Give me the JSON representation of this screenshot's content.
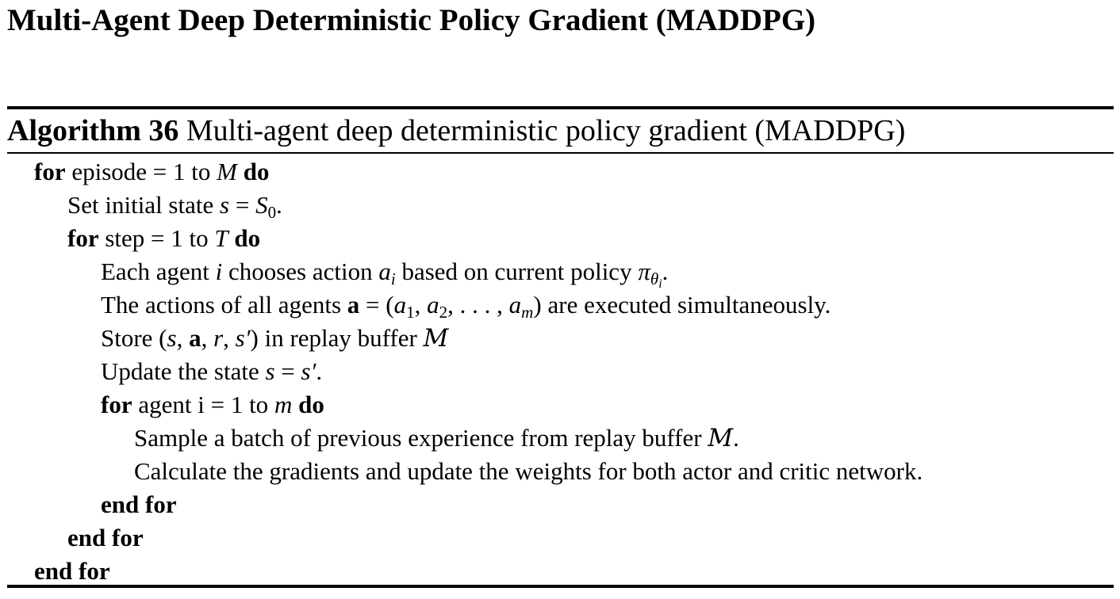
{
  "heading": "Multi-Agent Deep Deterministic Policy Gradient (MADDPG)",
  "algorithm": {
    "number_label": "Algorithm 36",
    "title": "Multi-agent deep deterministic policy gradient (MADDPG)"
  },
  "keywords": {
    "for": "for",
    "do": "do",
    "end_for": "end for"
  },
  "lines": {
    "l1_text": "episode = 1 to",
    "l1_var": "M",
    "l2_text": "Set initial state",
    "l2_var": "s",
    "l2_eq": "=",
    "l2_state": "S",
    "l2_sub": "0",
    "l2_end": ".",
    "l3_text": "step = 1 to",
    "l3_var": "T",
    "l4_a": "Each agent",
    "l4_i": "i",
    "l4_b": "chooses action",
    "l4_ai": "a",
    "l4_ai_sub": "i",
    "l4_c": "based on current policy",
    "l4_pi": "π",
    "l4_theta": "θ",
    "l4_theta_sub": "i",
    "l4_end": ".",
    "l5_a": "The actions of all agents",
    "l5_bold": "a",
    "l5_eq": "= (",
    "l5_a1": "a",
    "l5_a1_sub": "1",
    "l5_comma1": ", ",
    "l5_a2": "a",
    "l5_a2_sub": "2",
    "l5_dots": ", . . . , ",
    "l5_am": "a",
    "l5_am_sub": "m",
    "l5_close": ")",
    "l5_b": "are executed simultaneously.",
    "l6_a": "Store (",
    "l6_s": "s",
    "l6_c1": ", ",
    "l6_bold": "a",
    "l6_c2": ", ",
    "l6_r": "r",
    "l6_c3": ", ",
    "l6_sp": "s′",
    "l6_b": ") in replay buffer",
    "l6_buffer": "M",
    "l7_a": "Update the state",
    "l7_s": "s",
    "l7_eq": "=",
    "l7_sp": "s′",
    "l7_end": ".",
    "l8_text": "agent i = 1 to",
    "l8_var": "m",
    "l9_text": "Sample a batch of previous experience from replay buffer",
    "l9_buffer": "M",
    "l9_end": ".",
    "l10_text": "Calculate the gradients and update the weights for both actor and critic network."
  }
}
